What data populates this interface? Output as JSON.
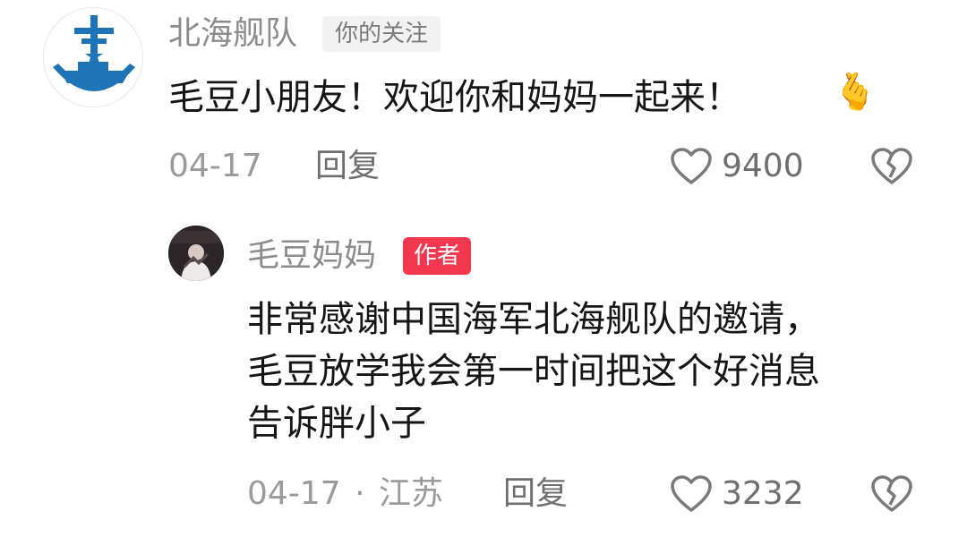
{
  "comments": [
    {
      "author": "北海舰队",
      "badge": "你的关注",
      "text": "毛豆小朋友！欢迎你和妈妈一起来！",
      "emoji": "🫰",
      "date": "04-17",
      "reply_label": "回复",
      "likes": "9400",
      "icons": [
        "avatar-anchor-ship-logo",
        "heart-outline-icon",
        "broken-heart-icon"
      ],
      "colors": {
        "avatar_blue": "#1f73b7"
      }
    },
    {
      "author": "毛豆妈妈",
      "badge": "作者",
      "lines": [
        "非常感谢中国海军北海舰队的邀请，",
        "毛豆放学我会第一时间把这个好消息",
        "告诉胖小子"
      ],
      "date": "04-17",
      "separator": "·",
      "location": "江苏",
      "reply_label": "回复",
      "likes": "3232",
      "icons": [
        "avatar-photo",
        "heart-outline-icon",
        "broken-heart-icon"
      ],
      "colors": {
        "author_badge": "#f2374e"
      }
    }
  ]
}
